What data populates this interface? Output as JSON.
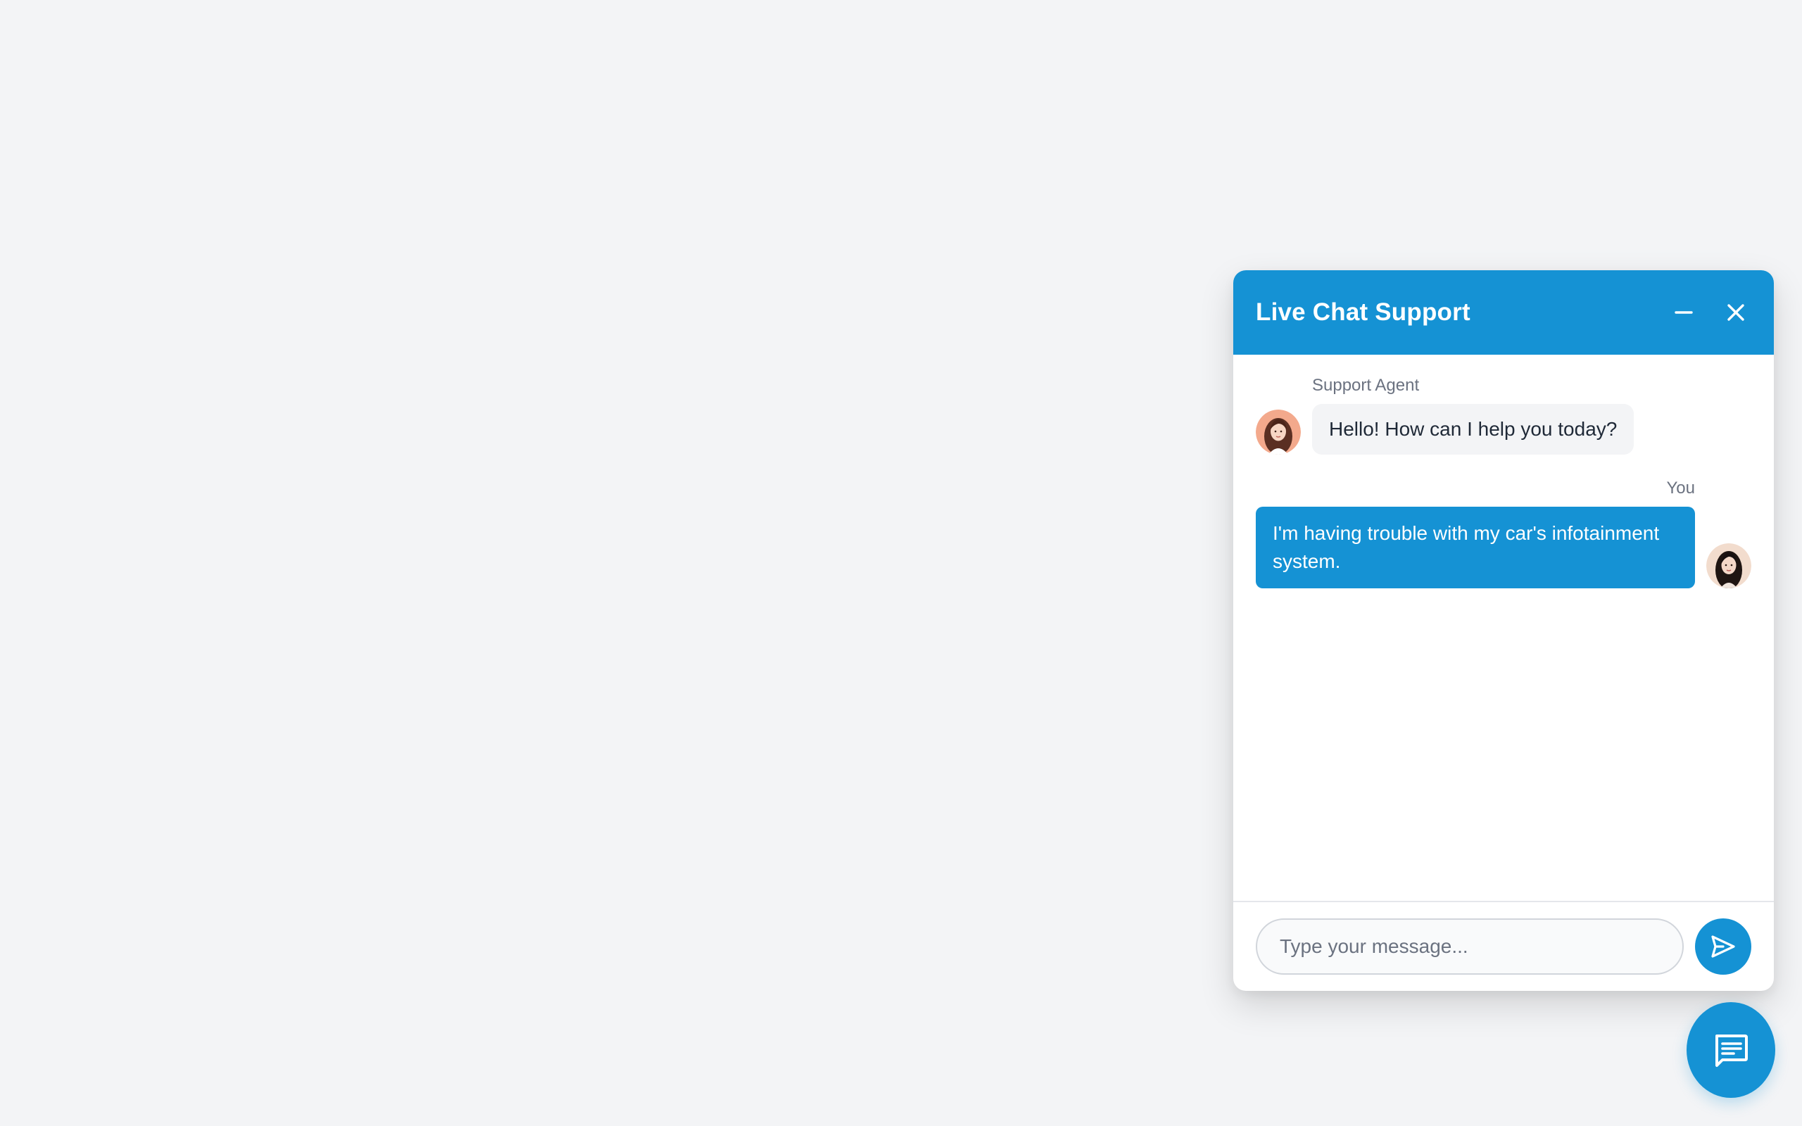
{
  "chat": {
    "title": "Live Chat Support",
    "minimize_icon": "minus-icon",
    "close_icon": "close-icon",
    "messages": [
      {
        "sender": "Support Agent",
        "text": "Hello! How can I help you today?",
        "avatar": "agent-avatar",
        "side": "left"
      },
      {
        "sender": "You",
        "text": "I'm having trouble with my car's infotainment system.",
        "avatar": "user-avatar",
        "side": "right"
      }
    ],
    "input": {
      "placeholder": "Type your message...",
      "value": ""
    },
    "send_icon": "send-icon"
  },
  "launcher": {
    "icon": "chat-bubble-icon"
  },
  "colors": {
    "accent": "#1592d4",
    "page_background": "#f3f4f6",
    "agent_bubble": "#f3f4f6"
  }
}
